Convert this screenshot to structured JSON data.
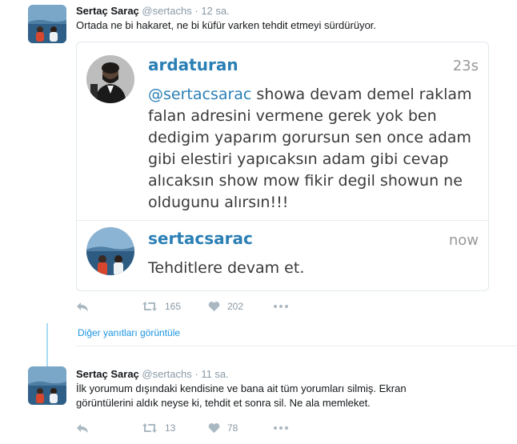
{
  "tweets": [
    {
      "name": "Sertaç Saraç",
      "handle": "@sertachs",
      "dot": "·",
      "time": "12 sa.",
      "text": "Ortada ne bi hakaret, ne bi küfür varken tehdit etmeyi sürdürüyor.",
      "retweets": "165",
      "likes": "202"
    },
    {
      "name": "Sertaç Saraç",
      "handle": "@sertachs",
      "dot": "·",
      "time": "11 sa.",
      "text": "İlk yorumum dışındaki kendisine ve bana ait tüm yorumları silmiş. Ekran görüntülerini aldık neyse ki, tehdit et sonra sil. Ne ala memleket.",
      "retweets": "13",
      "likes": "78"
    }
  ],
  "embed": {
    "messages": [
      {
        "user": "ardaturan",
        "time": "23s",
        "mention": "@sertacsarac",
        "text": " showa devam demel raklam falan adresini vermene gerek yok ben dedigim yaparım gorursun sen once adam gibi elestiri yapıcaksın adam gibi cevap alıcaksın show mow fikir degil showun ne oldugunu alırsın!!!"
      },
      {
        "user": "sertacsarac",
        "time": "now",
        "text": "Tehditlere devam et."
      }
    ]
  },
  "thread": {
    "more_replies": "Diğer yanıtları görüntüle"
  },
  "icons": {
    "reply": "reply-icon",
    "retweet": "retweet-icon",
    "like": "heart-icon",
    "more": "more-icon"
  },
  "colors": {
    "link": "#1b95e0",
    "thread_line": "#aadcf1",
    "muted": "#8899a6",
    "embed_username": "#2a7fb5"
  }
}
